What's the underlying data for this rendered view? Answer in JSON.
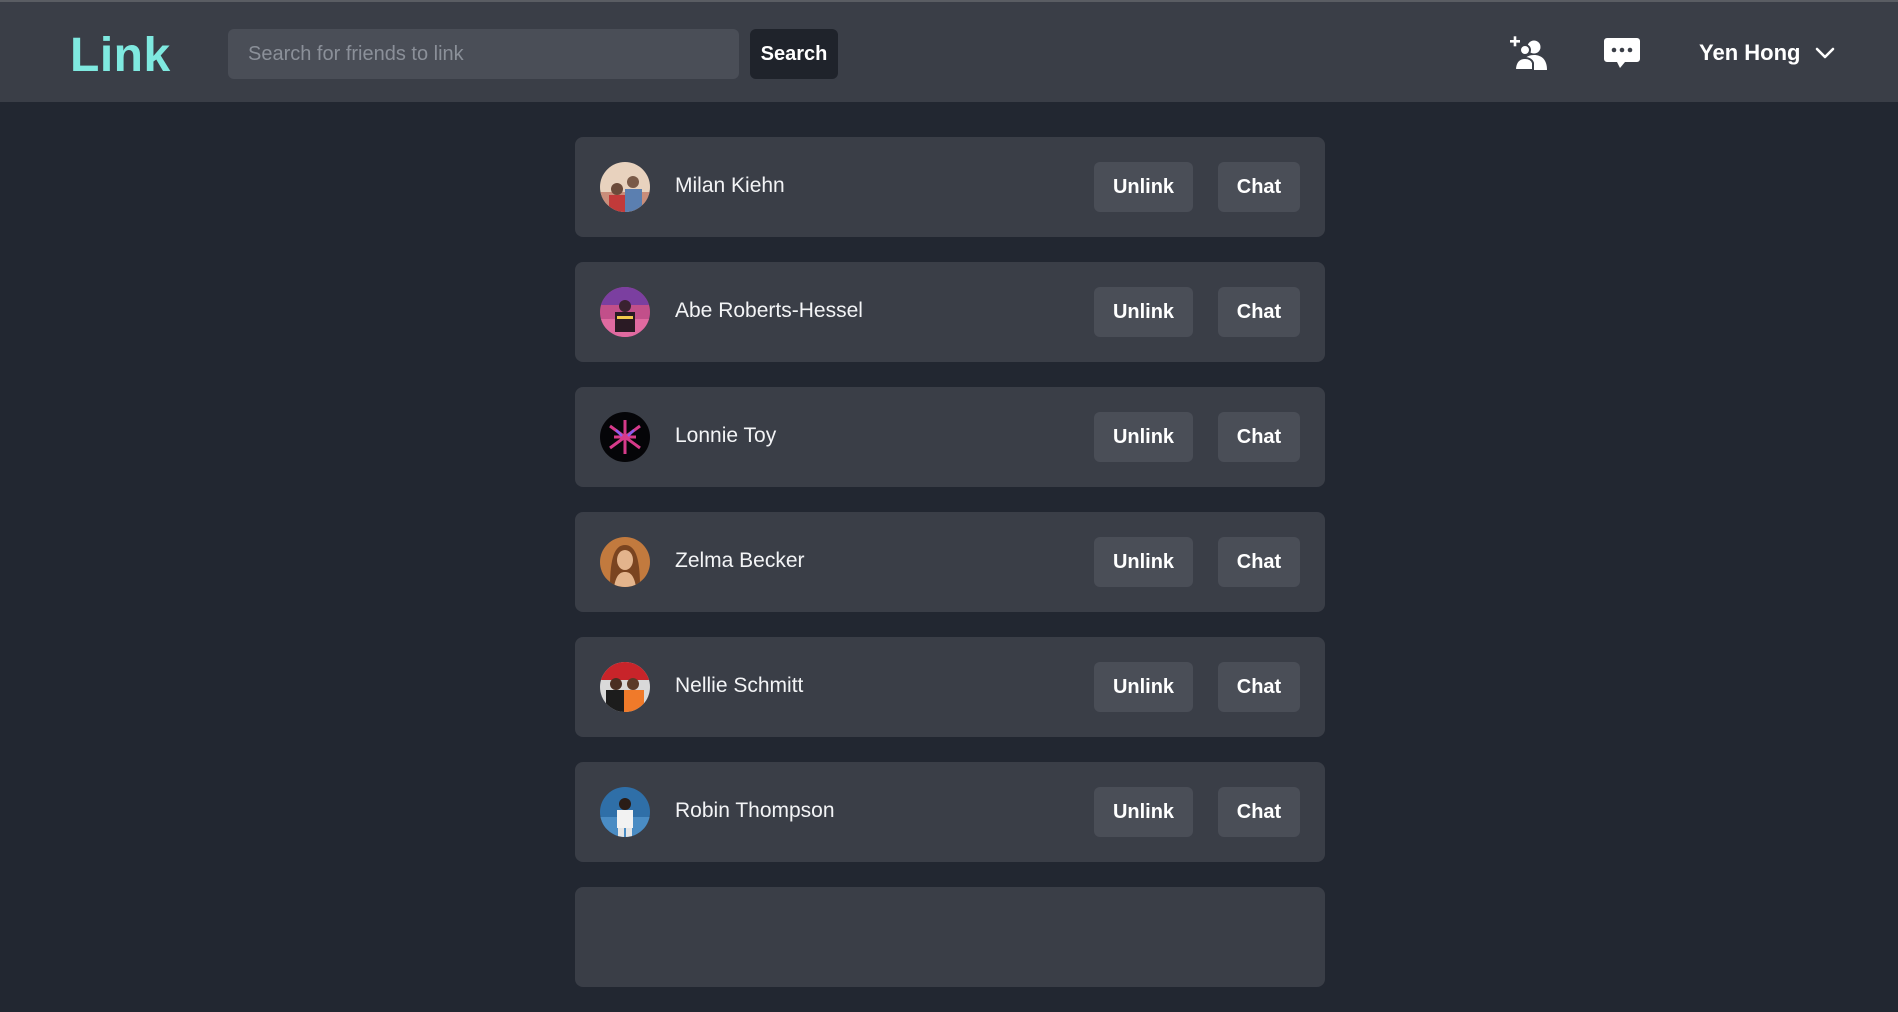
{
  "header": {
    "logo": "Link",
    "search_placeholder": "Search for friends to link",
    "search_value": "",
    "search_button": "Search",
    "user_name": "Yen Hong"
  },
  "friends": [
    {
      "name": "Milan Kiehn",
      "unlink_label": "Unlink",
      "chat_label": "Chat"
    },
    {
      "name": "Abe Roberts-Hessel",
      "unlink_label": "Unlink",
      "chat_label": "Chat"
    },
    {
      "name": "Lonnie Toy",
      "unlink_label": "Unlink",
      "chat_label": "Chat"
    },
    {
      "name": "Zelma Becker",
      "unlink_label": "Unlink",
      "chat_label": "Chat"
    },
    {
      "name": "Nellie Schmitt",
      "unlink_label": "Unlink",
      "chat_label": "Chat"
    },
    {
      "name": "Robin Thompson",
      "unlink_label": "Unlink",
      "chat_label": "Chat"
    }
  ],
  "icons": {
    "add_friend": "add-friend-icon",
    "messages": "chat-bubble-icon",
    "dropdown": "chevron-down-icon"
  },
  "colors": {
    "background": "#222731",
    "surface": "#3a3e47",
    "button": "#4a4e57",
    "accent": "#7fe9e0"
  }
}
